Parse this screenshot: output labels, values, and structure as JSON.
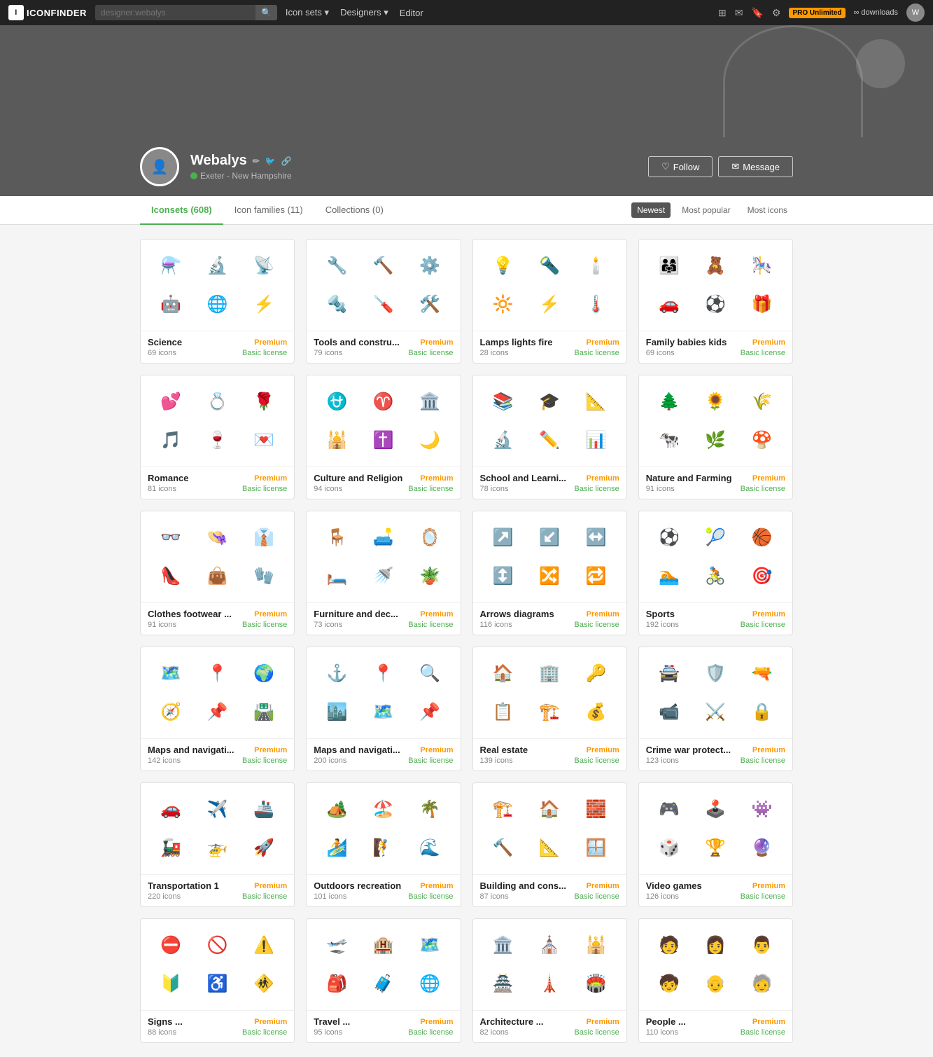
{
  "nav": {
    "logo": "ICONFINDER",
    "search_placeholder": "designer:webalys",
    "links": [
      {
        "label": "Icon sets",
        "has_dropdown": true
      },
      {
        "label": "Designers",
        "has_dropdown": true
      },
      {
        "label": "Editor",
        "has_dropdown": false
      }
    ],
    "pro_label": "PRO Unlimited",
    "pro_sub": "∞ downloads"
  },
  "profile": {
    "name": "Webalys",
    "location": "Exeter - New Hampshire",
    "follow_label": "Follow",
    "message_label": "Message"
  },
  "tabs": [
    {
      "label": "Iconsets (608)",
      "active": true
    },
    {
      "label": "Icon families (11)",
      "active": false
    },
    {
      "label": "Collections (0)",
      "active": false
    }
  ],
  "sort": [
    {
      "label": "Newest",
      "active": true
    },
    {
      "label": "Most popular",
      "active": false
    },
    {
      "label": "Most icons",
      "active": false
    }
  ],
  "cards": [
    {
      "title": "Science",
      "count": "69 icons",
      "badge": "Premium",
      "license": "Basic license",
      "icons": [
        "⚗️",
        "🔬",
        "📡",
        "🤖",
        "🌐",
        "⚡"
      ]
    },
    {
      "title": "Tools and constru...",
      "count": "79 icons",
      "badge": "Premium",
      "license": "Basic license",
      "icons": [
        "🔧",
        "🔨",
        "⚙️",
        "🔩",
        "🪛",
        "🛠️"
      ]
    },
    {
      "title": "Lamps lights fire",
      "count": "28 icons",
      "badge": "Premium",
      "license": "Basic license",
      "icons": [
        "💡",
        "🔦",
        "🕯️",
        "🔆",
        "⚡",
        "🌡️"
      ]
    },
    {
      "title": "Family babies kids",
      "count": "69 icons",
      "badge": "Premium",
      "license": "Basic license",
      "icons": [
        "👨‍👩‍👧",
        "🧸",
        "🎠",
        "🚗",
        "⚽",
        "🎁"
      ]
    },
    {
      "title": "Romance",
      "count": "81 icons",
      "badge": "Premium",
      "license": "Basic license",
      "icons": [
        "💕",
        "💍",
        "🌹",
        "🎵",
        "🍷",
        "💌"
      ]
    },
    {
      "title": "Culture and Religion",
      "count": "94 icons",
      "badge": "Premium",
      "license": "Basic license",
      "icons": [
        "⛎",
        "♈",
        "🏛️",
        "🕌",
        "✝️",
        "🌙"
      ]
    },
    {
      "title": "School and Learni...",
      "count": "78 icons",
      "badge": "Premium",
      "license": "Basic license",
      "icons": [
        "📚",
        "🎓",
        "📐",
        "🔬",
        "✏️",
        "📊"
      ]
    },
    {
      "title": "Nature and Farming",
      "count": "91 icons",
      "badge": "Premium",
      "license": "Basic license",
      "icons": [
        "🌲",
        "🌻",
        "🌾",
        "🐄",
        "🌿",
        "🍄"
      ]
    },
    {
      "title": "Clothes footwear ...",
      "count": "91 icons",
      "badge": "Premium",
      "license": "Basic license",
      "icons": [
        "👓",
        "👒",
        "👔",
        "👠",
        "👜",
        "🧤"
      ]
    },
    {
      "title": "Furniture and dec...",
      "count": "73 icons",
      "badge": "Premium",
      "license": "Basic license",
      "icons": [
        "🪑",
        "🛋️",
        "🪞",
        "🛏️",
        "🚿",
        "🪴"
      ]
    },
    {
      "title": "Arrows diagrams",
      "count": "116 icons",
      "badge": "Premium",
      "license": "Basic license",
      "icons": [
        "↗️",
        "↙️",
        "↔️",
        "↕️",
        "🔀",
        "🔁"
      ]
    },
    {
      "title": "Sports",
      "count": "192 icons",
      "badge": "Premium",
      "license": "Basic license",
      "icons": [
        "⚽",
        "🎾",
        "🏀",
        "🏊",
        "🚴",
        "🎯"
      ]
    },
    {
      "title": "Maps and navigati...",
      "count": "142 icons",
      "badge": "Premium",
      "license": "Basic license",
      "icons": [
        "🗺️",
        "📍",
        "🌍",
        "🧭",
        "📌",
        "🛣️"
      ]
    },
    {
      "title": "Maps and navigati...",
      "count": "200 icons",
      "badge": "Premium",
      "license": "Basic license",
      "icons": [
        "⚓",
        "📍",
        "🔍",
        "🏙️",
        "🗺️",
        "📌"
      ]
    },
    {
      "title": "Real estate",
      "count": "139 icons",
      "badge": "Premium",
      "license": "Basic license",
      "icons": [
        "🏠",
        "🏢",
        "🔑",
        "📋",
        "🏗️",
        "💰"
      ]
    },
    {
      "title": "Crime war protect...",
      "count": "123 icons",
      "badge": "Premium",
      "license": "Basic license",
      "icons": [
        "🚔",
        "🛡️",
        "🔫",
        "📹",
        "⚔️",
        "🔒"
      ]
    },
    {
      "title": "Transportation 1",
      "count": "220 icons",
      "badge": "Premium",
      "license": "Basic license",
      "icons": [
        "🚗",
        "✈️",
        "🚢",
        "🚂",
        "🚁",
        "🚀"
      ]
    },
    {
      "title": "Outdoors recreation",
      "count": "101 icons",
      "badge": "Premium",
      "license": "Basic license",
      "icons": [
        "🏕️",
        "🏖️",
        "🌴",
        "🏄",
        "🧗",
        "🌊"
      ]
    },
    {
      "title": "Building and cons...",
      "count": "87 icons",
      "badge": "Premium",
      "license": "Basic license",
      "icons": [
        "🏗️",
        "🏠",
        "🧱",
        "🔨",
        "📐",
        "🪟"
      ]
    },
    {
      "title": "Video games",
      "count": "126 icons",
      "badge": "Premium",
      "license": "Basic license",
      "icons": [
        "🎮",
        "🕹️",
        "👾",
        "🎲",
        "🏆",
        "🔮"
      ]
    },
    {
      "title": "Signs ...",
      "count": "88 icons",
      "badge": "Premium",
      "license": "Basic license",
      "icons": [
        "⛔",
        "🚫",
        "⚠️",
        "🔰",
        "♿",
        "🚸"
      ]
    },
    {
      "title": "Travel ...",
      "count": "95 icons",
      "badge": "Premium",
      "license": "Basic license",
      "icons": [
        "🛫",
        "🏨",
        "🗺️",
        "🎒",
        "🧳",
        "🌐"
      ]
    },
    {
      "title": "Architecture ...",
      "count": "82 icons",
      "badge": "Premium",
      "license": "Basic license",
      "icons": [
        "🏛️",
        "⛪",
        "🕌",
        "🏯",
        "🗼",
        "🏟️"
      ]
    },
    {
      "title": "People ...",
      "count": "110 icons",
      "badge": "Premium",
      "license": "Basic license",
      "icons": [
        "🧑",
        "👩",
        "👨",
        "🧒",
        "👴",
        "🧓"
      ]
    }
  ]
}
